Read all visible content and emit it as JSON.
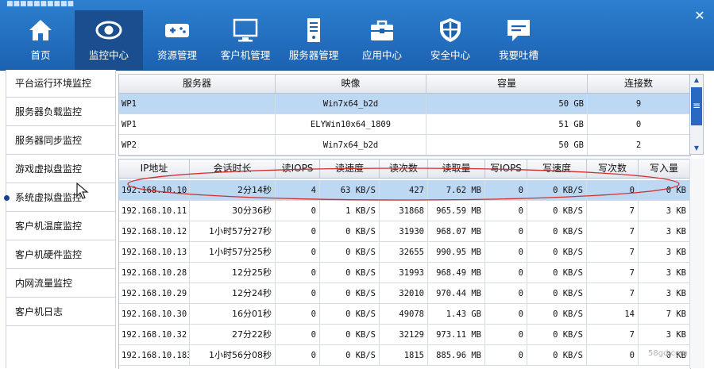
{
  "window": {
    "title": "■■■■■■■■■■"
  },
  "nav": [
    {
      "label": "首页",
      "icon": "home-icon"
    },
    {
      "label": "监控中心",
      "icon": "eye-icon"
    },
    {
      "label": "资源管理",
      "icon": "gamepad-icon"
    },
    {
      "label": "客户机管理",
      "icon": "monitor-icon"
    },
    {
      "label": "服务器管理",
      "icon": "server-icon"
    },
    {
      "label": "应用中心",
      "icon": "toolbox-icon"
    },
    {
      "label": "安全中心",
      "icon": "shield-icon"
    },
    {
      "label": "我要吐槽",
      "icon": "chat-icon"
    }
  ],
  "nav_active": "监控中心",
  "sidebar": [
    "平台运行环境监控",
    "服务器负载监控",
    "服务器同步监控",
    "游戏虚拟盘监控",
    "系统虚拟盘监控",
    "客户机温度监控",
    "客户机硬件监控",
    "内网流量监控",
    "客户机日志"
  ],
  "sidebar_active": "系统虚拟盘监控",
  "server_table": {
    "headers": [
      "服务器",
      "映像",
      "容量",
      "连接数"
    ],
    "rows": [
      [
        "WP1",
        "Win7x64_b2d",
        "50 GB",
        "9"
      ],
      [
        "WP1",
        "ELYWin10x64_1809",
        "51 GB",
        "0"
      ],
      [
        "WP2",
        "Win7x64_b2d",
        "50 GB",
        "2"
      ]
    ]
  },
  "session_table": {
    "headers": [
      "IP地址",
      "会话时长",
      "读IOPS",
      "读速度",
      "读次数",
      "读取量",
      "写IOPS",
      "写速度",
      "写次数",
      "写入量"
    ],
    "rows": [
      [
        "192.168.10.10",
        "2分14秒",
        "4",
        "63 KB/S",
        "427",
        "7.62 MB",
        "0",
        "0 KB/S",
        "0",
        "0 KB"
      ],
      [
        "192.168.10.11",
        "30分36秒",
        "0",
        "1 KB/S",
        "31868",
        "965.59 MB",
        "0",
        "0 KB/S",
        "7",
        "3 KB"
      ],
      [
        "192.168.10.12",
        "1小时57分27秒",
        "0",
        "0 KB/S",
        "31930",
        "968.07 MB",
        "0",
        "0 KB/S",
        "7",
        "3 KB"
      ],
      [
        "192.168.10.13",
        "1小时57分25秒",
        "0",
        "0 KB/S",
        "32655",
        "990.95 MB",
        "0",
        "0 KB/S",
        "7",
        "3 KB"
      ],
      [
        "192.168.10.28",
        "12分25秒",
        "0",
        "0 KB/S",
        "31993",
        "968.49 MB",
        "0",
        "0 KB/S",
        "7",
        "3 KB"
      ],
      [
        "192.168.10.29",
        "12分24秒",
        "0",
        "0 KB/S",
        "32010",
        "970.44 MB",
        "0",
        "0 KB/S",
        "7",
        "3 KB"
      ],
      [
        "192.168.10.30",
        "16分01秒",
        "0",
        "0 KB/S",
        "49078",
        "1.43 GB",
        "0",
        "0 KB/S",
        "14",
        "7 KB"
      ],
      [
        "192.168.10.32",
        "27分22秒",
        "0",
        "0 KB/S",
        "32129",
        "973.11 MB",
        "0",
        "0 KB/S",
        "7",
        "3 KB"
      ],
      [
        "192.168.10.183",
        "1小时56分08秒",
        "0",
        "0 KB/S",
        "1815",
        "885.96 MB",
        "0",
        "0 KB/S",
        "0",
        "0 KB"
      ]
    ]
  },
  "watermark": "58gd.com",
  "colors": {
    "topbar": "#1c62b1",
    "active_nav": "#1a4e8f",
    "selection": "#bcd8f3",
    "annotation": "#d03030"
  }
}
